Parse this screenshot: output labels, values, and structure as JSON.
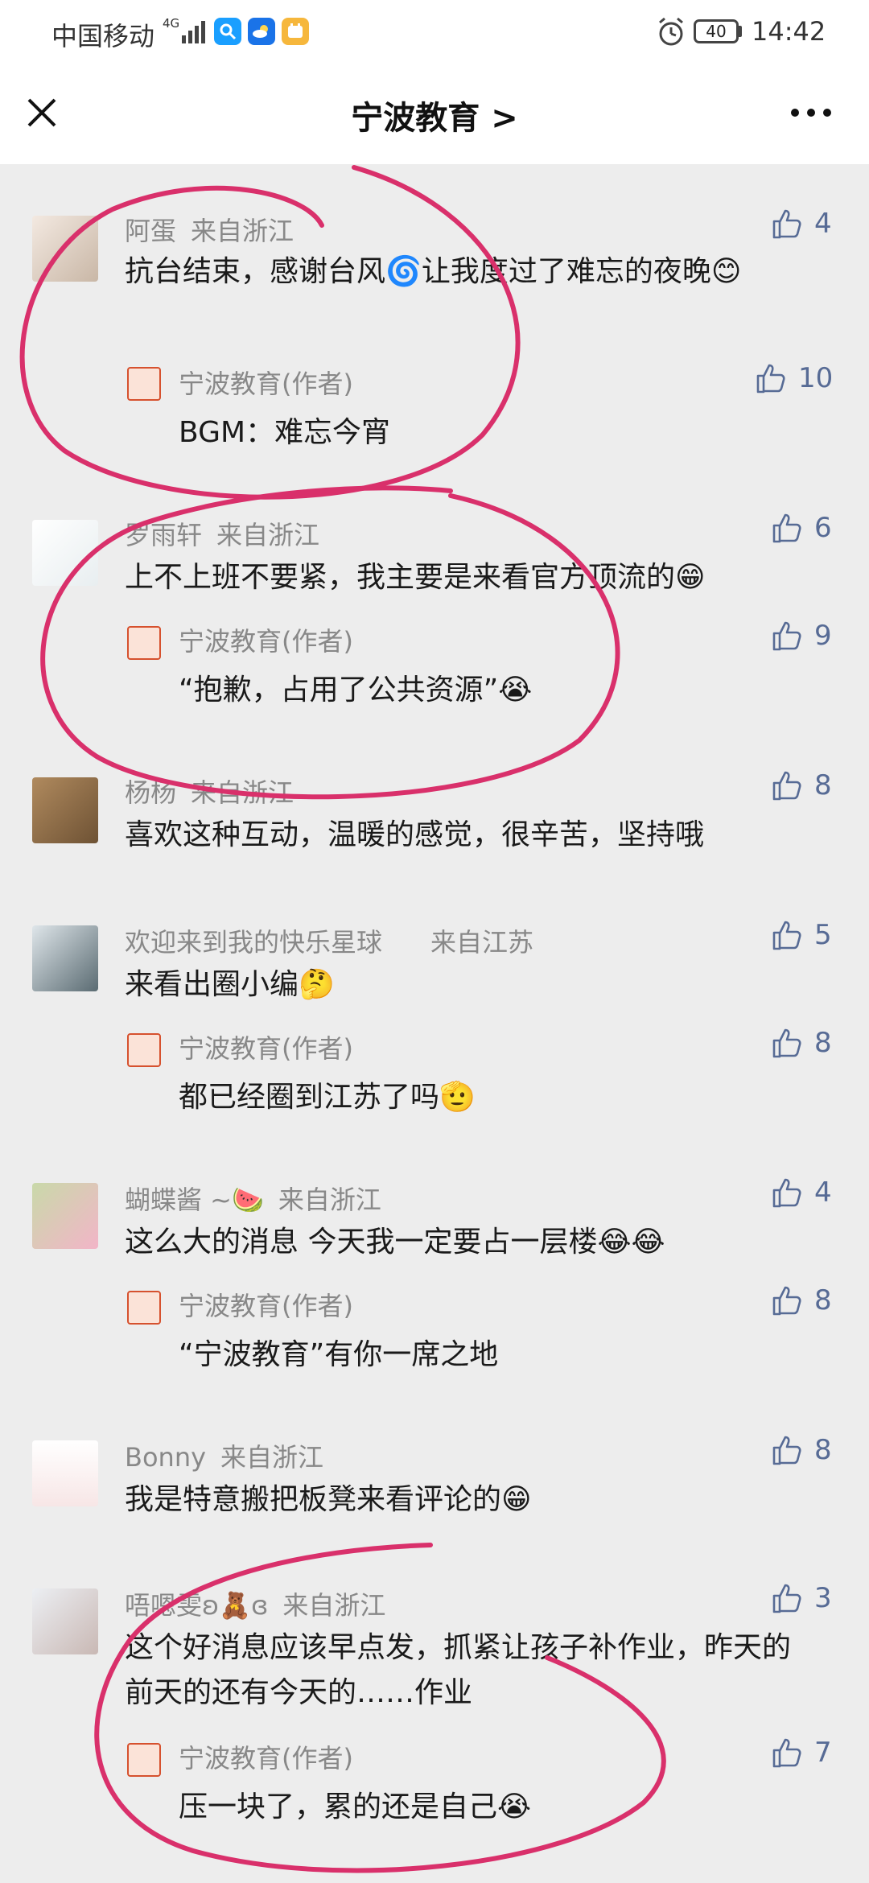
{
  "status_bar": {
    "carrier": "中国移动",
    "network": "4G",
    "battery": "40",
    "time": "14:42"
  },
  "nav": {
    "title": "宁波教育 >",
    "icons": [
      "close-icon",
      "more-icon"
    ]
  },
  "colors": {
    "background": "#ededed",
    "like_blue": "#576b95",
    "annotation": "#d9306b"
  },
  "comments": [
    {
      "user": "阿蛋",
      "from": "来自浙江",
      "likes": "4",
      "text": "抗台结束，感谢台风🌀让我度过了难忘的夜晚😊",
      "reply": {
        "author": "宁波教育(作者)",
        "text": "BGM：难忘今宵",
        "likes": "10"
      }
    },
    {
      "user": "罗雨轩",
      "from": "来自浙江",
      "likes": "6",
      "text": "上不上班不要紧，我主要是来看官方顶流的😁",
      "reply": {
        "author": "宁波教育(作者)",
        "text": "“抱歉，占用了公共资源”😭",
        "likes": "9"
      }
    },
    {
      "user": "杨杨",
      "from": "来自浙江",
      "likes": "8",
      "text": "喜欢这种互动，温暖的感觉，很辛苦，坚持哦"
    },
    {
      "user": "欢迎来到我的快乐星球",
      "from": "来自江苏",
      "likes": "5",
      "text": "来看出圈小编🤔",
      "reply": {
        "author": "宁波教育(作者)",
        "text": "都已经圈到江苏了吗🫡",
        "likes": "8"
      }
    },
    {
      "user": "蝴蝶酱 ~🍉",
      "from": "来自浙江",
      "likes": "4",
      "text": "这么大的消息 今天我一定要占一层楼😂😂",
      "reply": {
        "author": "宁波教育(作者)",
        "text": "“宁波教育”有你一席之地",
        "likes": "8"
      }
    },
    {
      "user": "Bonny",
      "from": "来自浙江",
      "likes": "8",
      "text": "我是特意搬把板凳来看评论的😁"
    },
    {
      "user": "唔嗯雯ʚ🧸ɞ",
      "from": "来自浙江",
      "likes": "3",
      "text": "这个好消息应该早点发，抓紧让孩子补作业，昨天的前天的还有今天的……作业",
      "reply": {
        "author": "宁波教育(作者)",
        "text": "压一块了，累的还是自己😭",
        "likes": "7"
      }
    }
  ]
}
